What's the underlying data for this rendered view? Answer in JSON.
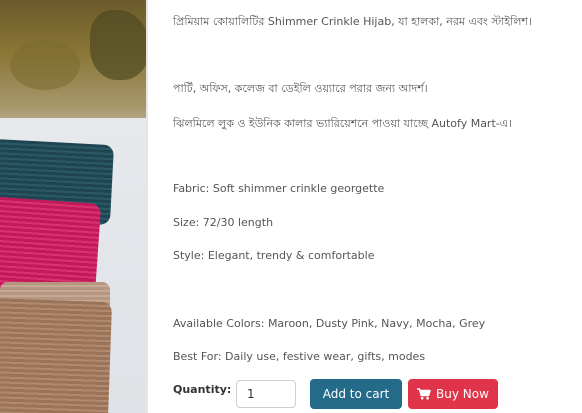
{
  "product": {
    "description_lines": [
      "প্রিমিয়াম কোয়ালিটির Shimmer Crinkle Hijab, যা হালকা, নরম এবং স্টাইলিশ।",
      "পার্টি, অফিস, কলেজ বা ডেইলি ওয়্যারে পরার জন্য আদর্শ।",
      "ঝিলমিলে লুক ও ইউনিক কালার ভ্যারিয়েশনে পাওয়া যাচ্ছে Autofy Mart-এ।",
      "Fabric: Soft shimmer crinkle georgette",
      "Size: 72/30 length",
      "Style: Elegant, trendy & comfortable",
      "Available Colors: Maroon, Dusty Pink, Navy, Mocha, Grey",
      "Best For: Daily use, festive wear, gifts, modes"
    ]
  },
  "purchase": {
    "quantity_label": "Quantity:",
    "quantity_value": "1",
    "add_to_cart_label": "Add to cart",
    "buy_now_label": "Buy Now",
    "icons": {
      "buy_now": "shopping-cart-icon"
    },
    "colors": {
      "add_to_cart": "#236b88",
      "buy_now": "#df3449"
    }
  }
}
